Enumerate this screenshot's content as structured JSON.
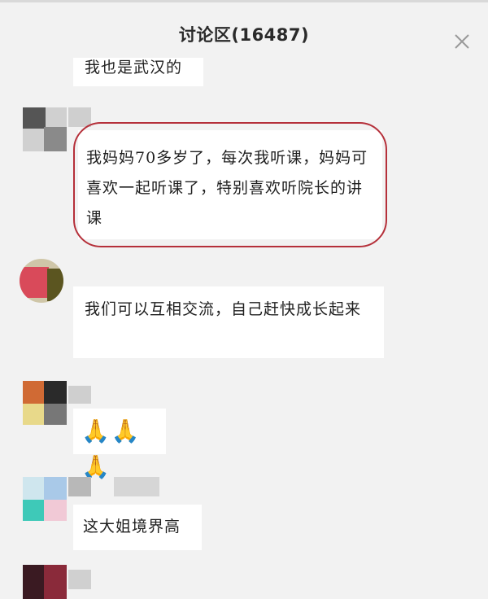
{
  "header": {
    "title": "讨论区(16487)",
    "close_icon": "close-icon"
  },
  "messages": [
    {
      "text": "我也是武汉的"
    },
    {
      "text": "我妈妈70多岁了，每次我听课，妈妈可喜欢一起听课了，特别喜欢听院长的讲课"
    },
    {
      "text": "我们可以互相交流，自己赶快成长起来"
    },
    {
      "text": "🙏🙏🙏"
    },
    {
      "text": "这大姐境界高"
    }
  ],
  "colors": {
    "highlight": "#b5303a",
    "background": "#f2f2f2",
    "bubble": "#ffffff"
  }
}
